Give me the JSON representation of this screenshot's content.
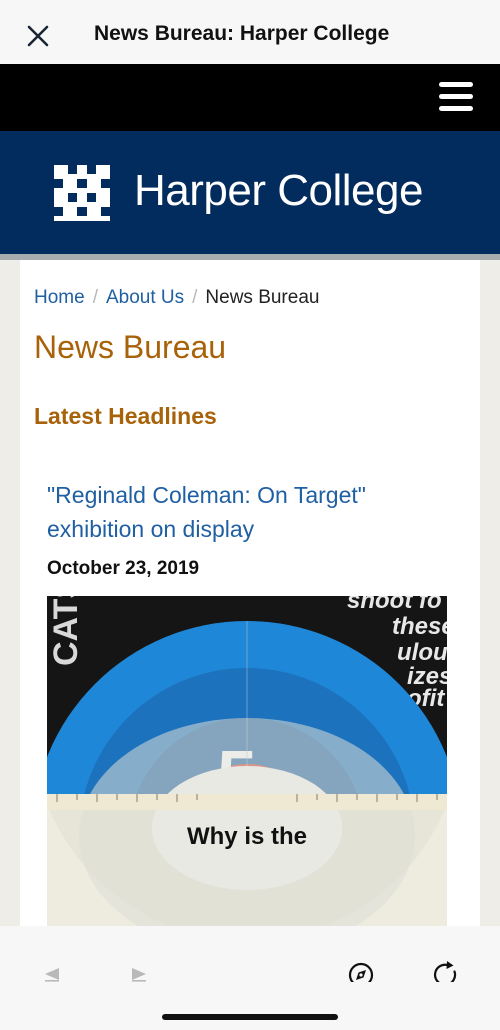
{
  "browser": {
    "title": "News Bureau: Harper College",
    "close_icon": "close-icon",
    "toolbar": {
      "back_icon": "back-arrow-icon",
      "forward_icon": "forward-arrow-icon",
      "compass_icon": "compass-icon",
      "reload_icon": "reload-icon"
    }
  },
  "site": {
    "menu_icon": "hamburger-menu-icon",
    "brand": "Harper College",
    "logo_icon": "harper-logo-icon",
    "colors": {
      "nav": "#000000",
      "header": "#032c5e",
      "accent": "#a8620a",
      "link": "#1f5fa3"
    }
  },
  "breadcrumb": {
    "items": [
      "Home",
      "About Us"
    ],
    "current": "News Bureau",
    "separator": "/"
  },
  "page": {
    "title": "News Bureau",
    "section_title": "Latest Headlines"
  },
  "article": {
    "headline": "\"Reginald Coleman: On Target\" exhibition on display",
    "date": "October 23, 2019",
    "image": {
      "caption_text": "Why is the",
      "left_text": "CATS",
      "right_text_lines": [
        "shoot fo",
        "these",
        "ulous",
        "izes",
        "ofit"
      ],
      "figure_text": "5"
    }
  }
}
